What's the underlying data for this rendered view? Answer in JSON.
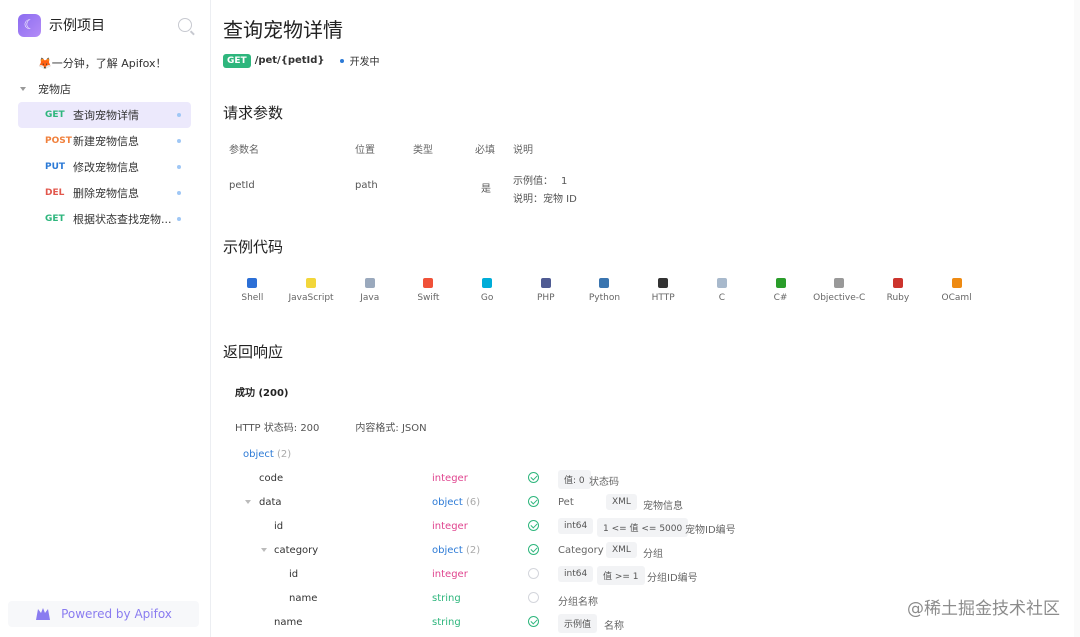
{
  "sidebar": {
    "project_title": "示例项目",
    "intro": "🦊一分钟，了解 Apifox！",
    "folder": "宠物店",
    "items": [
      {
        "method": "GET",
        "label": "查询宠物详情",
        "active": true
      },
      {
        "method": "POST",
        "label": "新建宠物信息",
        "active": false
      },
      {
        "method": "PUT",
        "label": "修改宠物信息",
        "active": false
      },
      {
        "method": "DEL",
        "label": "删除宠物信息",
        "active": false
      },
      {
        "method": "GET",
        "label": "根据状态查找宠物...",
        "active": false
      }
    ],
    "footer": "Powered by Apifox"
  },
  "page": {
    "title": "查询宠物详情",
    "method_badge": "GET",
    "path": "/pet/{petId}",
    "status": "开发中"
  },
  "params": {
    "section_title": "请求参数",
    "headers": [
      "参数名",
      "位置",
      "类型",
      "必填",
      "说明"
    ],
    "row": {
      "name": "petId",
      "location": "path",
      "type": "",
      "required": "是",
      "example_label": "示例值：",
      "example_value": "1",
      "desc": "说明：宠物 ID"
    }
  },
  "code": {
    "section_title": "示例代码",
    "languages": [
      {
        "name": "Shell",
        "color": "#2c6fd6"
      },
      {
        "name": "JavaScript",
        "color": "#f2d63a"
      },
      {
        "name": "Java",
        "color": "#9aa9bd"
      },
      {
        "name": "Swift",
        "color": "#f05138"
      },
      {
        "name": "Go",
        "color": "#00add8"
      },
      {
        "name": "PHP",
        "color": "#4f5b93"
      },
      {
        "name": "Python",
        "color": "#3a75b0"
      },
      {
        "name": "HTTP",
        "color": "#333333"
      },
      {
        "name": "C",
        "color": "#a8b9cc"
      },
      {
        "name": "C#",
        "color": "#2a9d2a"
      },
      {
        "name": "Objective-C",
        "color": "#999999"
      },
      {
        "name": "Ruby",
        "color": "#cc342d"
      },
      {
        "name": "OCaml",
        "color": "#ee8a12"
      }
    ]
  },
  "response": {
    "section_title": "返回响应",
    "tab": "成功 (200)",
    "http_status": "HTTP 状态码: 200",
    "content_type": "内容格式: JSON",
    "rows": [
      {
        "name": "object",
        "name_color": "obj",
        "count": "(2)",
        "type": "",
        "type_class": "",
        "type_count": "",
        "check": "",
        "tags": [],
        "desc": ""
      },
      {
        "name": "code",
        "type": "integer",
        "type_class": "int",
        "type_count": "",
        "check": "on",
        "tags": [
          "值: 0"
        ],
        "desc": "状态码"
      },
      {
        "name": "data",
        "type": "object",
        "type_class": "obj",
        "type_count": "(6)",
        "check": "on",
        "tags": [
          "Pet",
          "XML"
        ],
        "desc": "宠物信息"
      },
      {
        "name": "id",
        "type": "integer",
        "type_class": "int",
        "type_count": "",
        "check": "on",
        "tags": [
          "int64",
          "1 <= 值 <= 5000"
        ],
        "desc": "宠物ID编号"
      },
      {
        "name": "category",
        "type": "object",
        "type_class": "obj",
        "type_count": "(2)",
        "check": "on",
        "tags": [
          "Category",
          "XML"
        ],
        "desc": "分组"
      },
      {
        "name": "id",
        "type": "integer",
        "type_class": "int",
        "type_count": "",
        "check": "off",
        "tags": [
          "int64",
          "值 >= 1"
        ],
        "desc": "分组ID编号"
      },
      {
        "name": "name",
        "type": "string",
        "type_class": "str",
        "type_count": "",
        "check": "off",
        "tags": [],
        "desc": "分组名称"
      },
      {
        "name": "name",
        "type": "string",
        "type_class": "str",
        "type_count": "",
        "check": "on",
        "tags": [
          "示例值"
        ],
        "desc": "名称"
      }
    ]
  },
  "watermark": "@稀土掘金技术社区"
}
